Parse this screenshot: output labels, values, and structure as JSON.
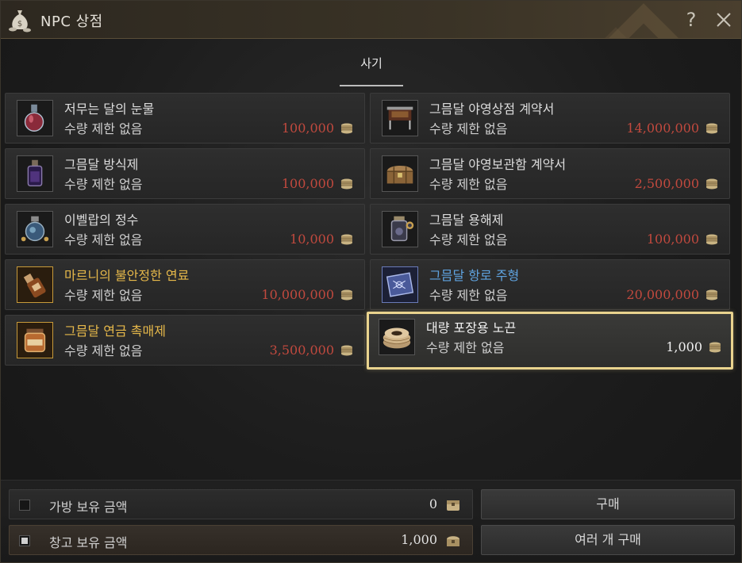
{
  "window": {
    "title": "NPC 상점",
    "help_label": "?"
  },
  "tabs": [
    {
      "label": "사기",
      "active": true
    }
  ],
  "items": [
    {
      "name": "저무는 달의 눈물",
      "limit": "수량 제한 없음",
      "price": "100,000",
      "name_color": "default",
      "icon": "potion-flask-icon"
    },
    {
      "name": "그믐달 야영상점 계약서",
      "limit": "수량 제한 없음",
      "price": "14,000,000",
      "name_color": "default",
      "icon": "camp-shop-icon"
    },
    {
      "name": "그믐달 방식제",
      "limit": "수량 제한 없음",
      "price": "100,000",
      "name_color": "default",
      "icon": "bottle-icon"
    },
    {
      "name": "그믐달 야영보관함 계약서",
      "limit": "수량 제한 없음",
      "price": "2,500,000",
      "name_color": "default",
      "icon": "chest-icon"
    },
    {
      "name": "이벨랍의 정수",
      "limit": "수량 제한 없음",
      "price": "10,000",
      "name_color": "default",
      "icon": "essence-jar-icon"
    },
    {
      "name": "그믐달 용해제",
      "limit": "수량 제한 없음",
      "price": "100,000",
      "name_color": "default",
      "icon": "solvent-jar-icon"
    },
    {
      "name": "마르니의 불안정한 연료",
      "limit": "수량 제한 없음",
      "price": "10,000,000",
      "name_color": "gold",
      "icon": "fuel-bottle-icon"
    },
    {
      "name": "그믐달 항로 주형",
      "limit": "수량 제한 없음",
      "price": "20,000,000",
      "name_color": "blue",
      "icon": "route-mold-icon"
    },
    {
      "name": "그믐달 연금 촉매제",
      "limit": "수량 제한 없음",
      "price": "3,500,000",
      "name_color": "gold",
      "icon": "catalyst-jar-icon"
    },
    {
      "name": "대량 포장용 노끈",
      "limit": "수량 제한 없음",
      "price": "1,000",
      "name_color": "white",
      "icon": "rope-coil-icon",
      "selected": true
    }
  ],
  "footer": {
    "inventory": {
      "label": "가방 보유 금액",
      "value": "0",
      "checked": false
    },
    "warehouse": {
      "label": "창고 보유 금액",
      "value": "1,000",
      "checked": true
    },
    "buy_button": "구매",
    "bulk_buy_button": "여러 개 구매"
  },
  "colors": {
    "price_red": "#c0493e",
    "gold_name": "#e6b84a",
    "blue_name": "#5fa3e0",
    "selection_border": "#e9d38e"
  }
}
